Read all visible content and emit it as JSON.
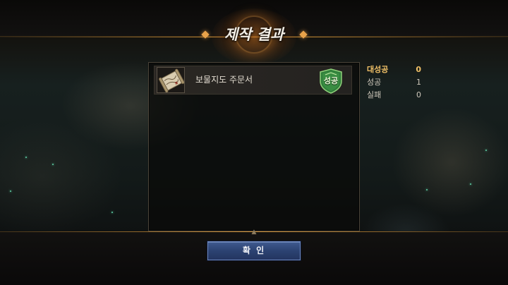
{
  "dialog": {
    "title": "제작 결과"
  },
  "results": [
    {
      "item_name": "보물지도 주문서",
      "item_icon": "treasure-map-scroll-icon",
      "badge": "성공",
      "badge_color": "#2f7d3a"
    }
  ],
  "stats": {
    "great_success_label": "대성공",
    "great_success_count": "0",
    "success_label": "성공",
    "success_count": "1",
    "fail_label": "실패",
    "fail_count": "0",
    "great_success_color": "#f0c067"
  },
  "confirm_label": "확 인",
  "colors": {
    "accent_gold": "#e8a24a",
    "button_blue": "#2c4272"
  }
}
